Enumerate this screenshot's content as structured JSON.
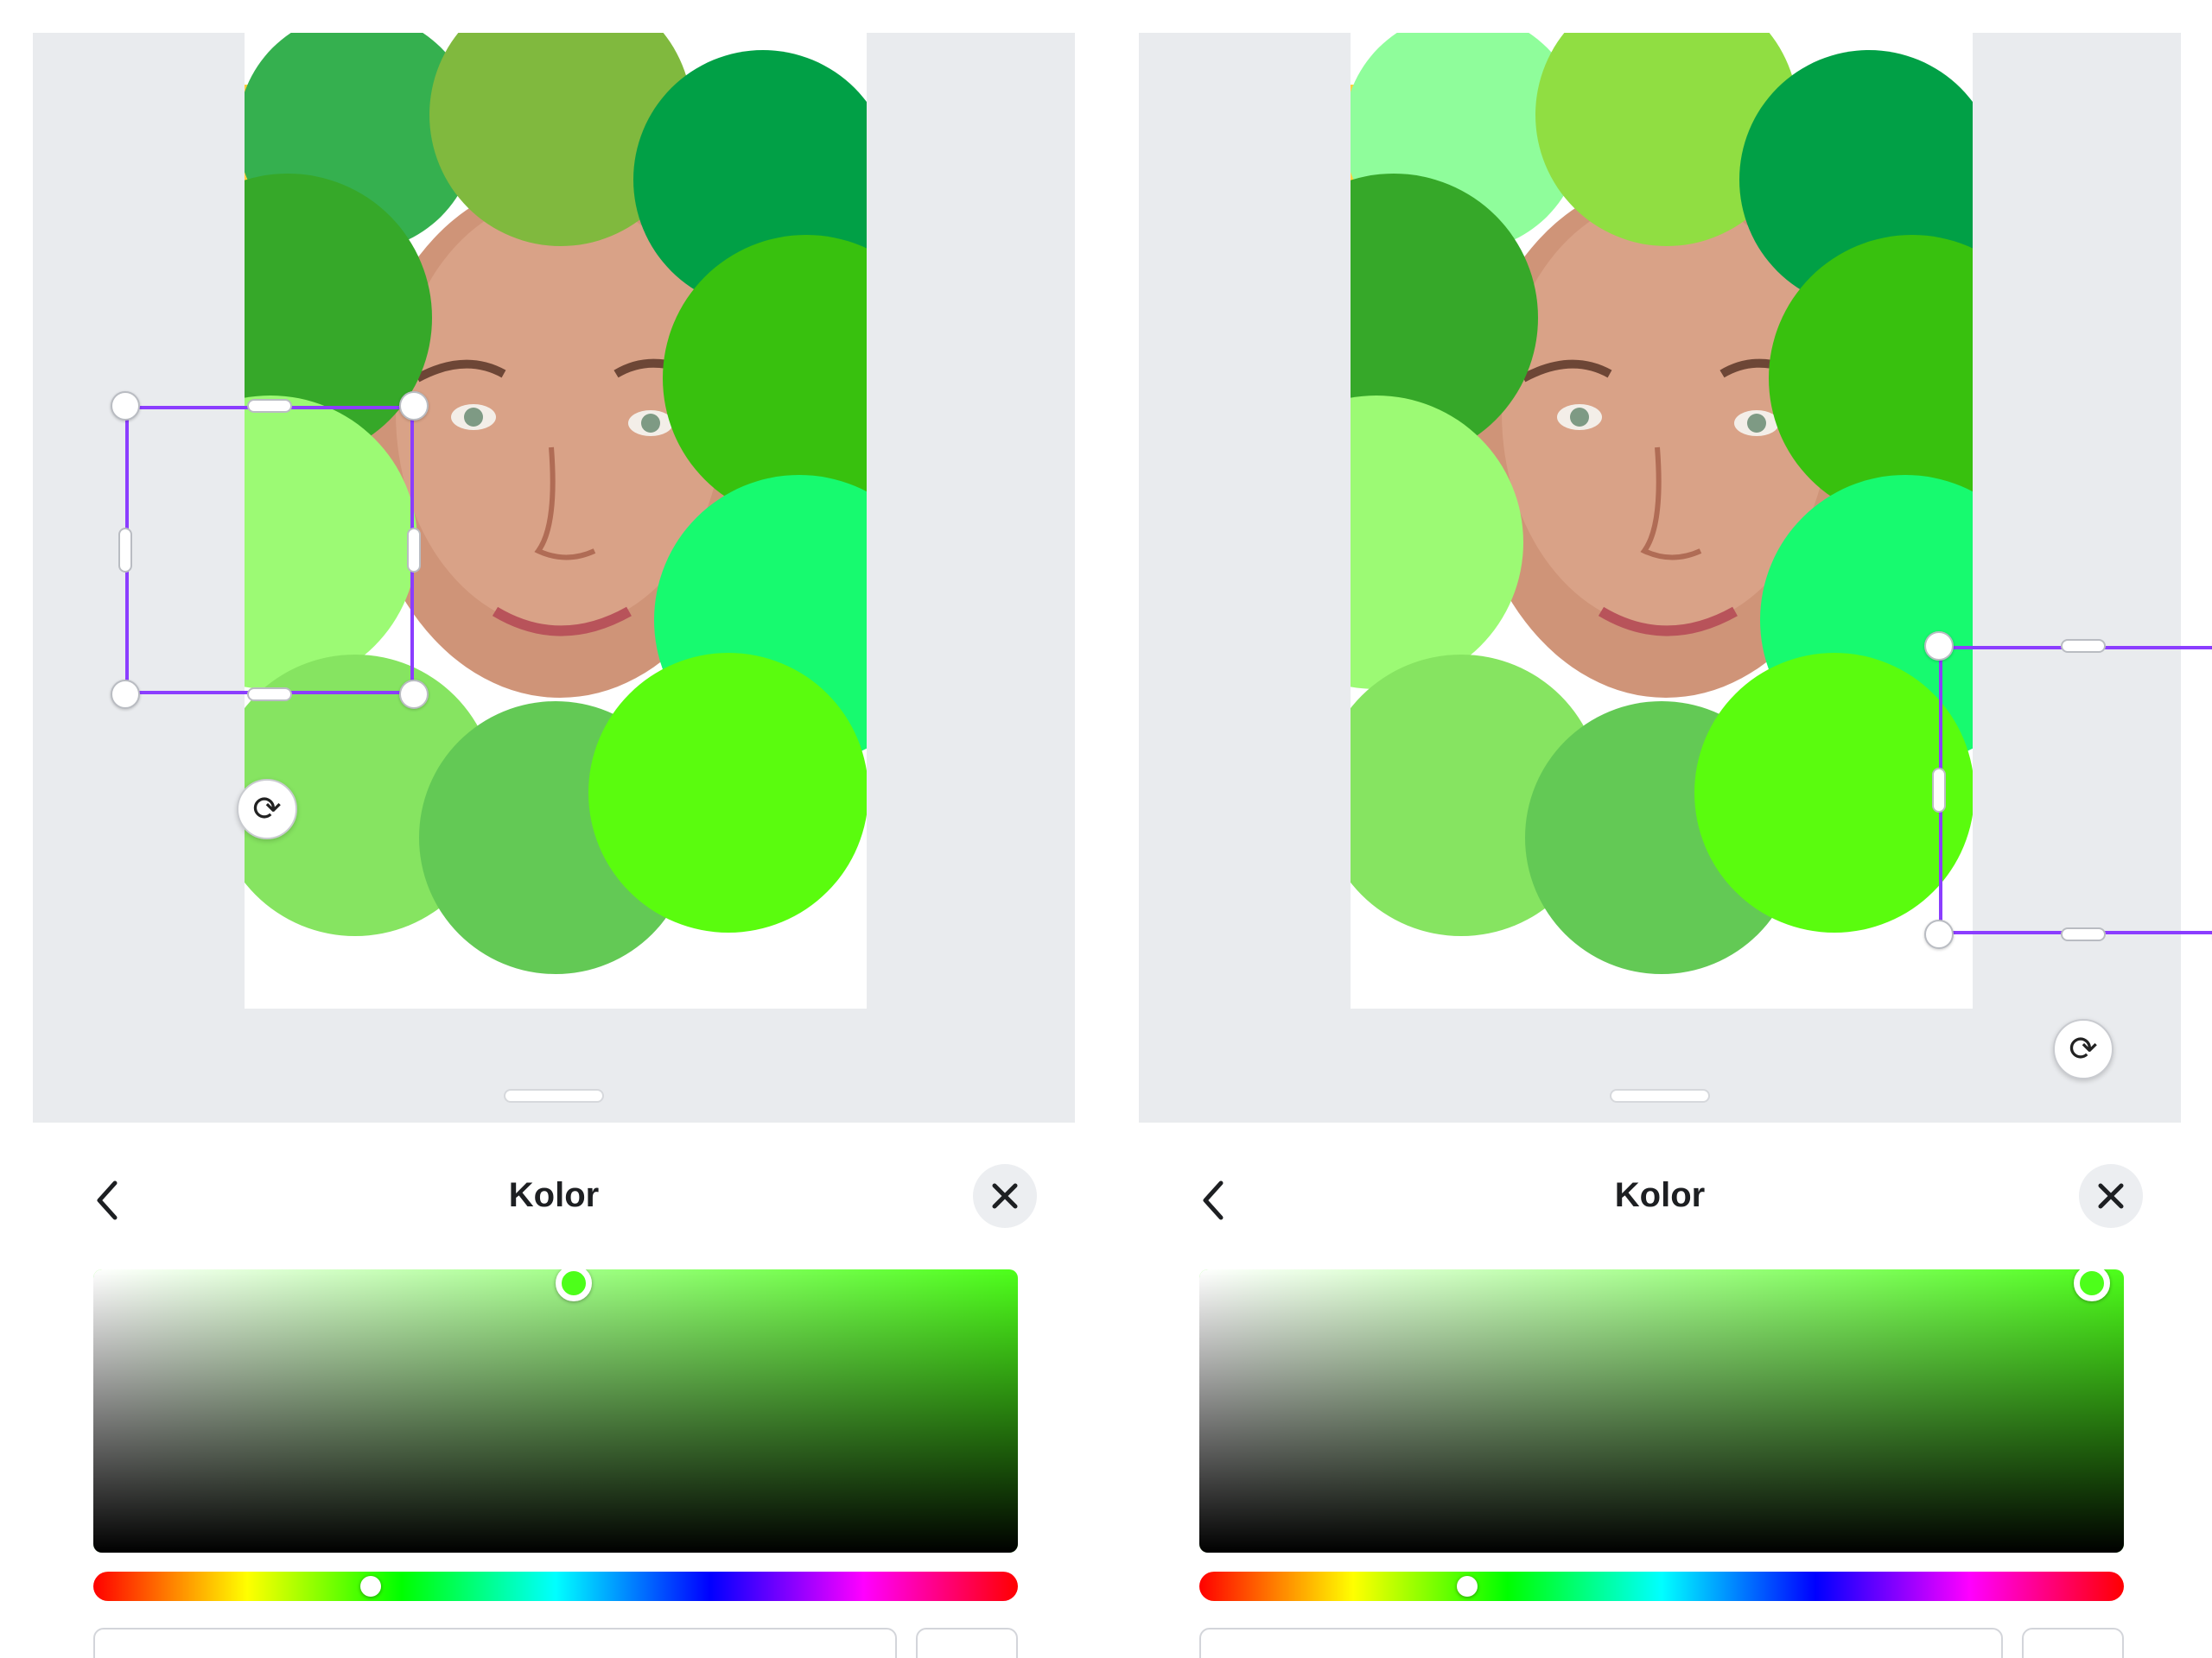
{
  "panels": [
    {
      "id": "left",
      "sheet": {
        "title": "Kolor"
      },
      "colors": {
        "circle_top_left": "#35b04f",
        "circle_top_mid": "#80b93e",
        "circle_top_right": "#01a046",
        "circle_upper_left": "#36a829",
        "circle_right_upper": "#38c10e",
        "circle_mid_left": "#9cfa74",
        "circle_right_mid": "#17fa6f",
        "circle_lower_left": "#86e461",
        "circle_bottom_mid": "#63c955",
        "circle_bottom_right": "#5afc0e",
        "selection": "#8b3dff"
      },
      "color_picker": {
        "saturation": 0.52,
        "brightness": 0.95,
        "hue_position": 0.3,
        "hue_color": "#4dff1a"
      }
    },
    {
      "id": "right",
      "sheet": {
        "title": "Kolor"
      },
      "colors": {
        "circle_top_left": "#8ffd9b",
        "circle_top_mid": "#90de42",
        "circle_top_right": "#01a046",
        "circle_upper_left": "#36a829",
        "circle_right_upper": "#38c10e",
        "circle_mid_left": "#9cfa74",
        "circle_right_mid": "#17fa6f",
        "circle_lower_left": "#86e461",
        "circle_bottom_mid": "#63c955",
        "circle_bottom_right": "#5afc0e",
        "selection": "#8b3dff"
      },
      "color_picker": {
        "saturation": 0.965,
        "brightness": 0.95,
        "hue_position": 0.29,
        "hue_color": "#4dff1a"
      }
    }
  ],
  "icons": {
    "back": "chevron-left-icon",
    "close": "close-icon",
    "rotate": "rotate-icon"
  }
}
